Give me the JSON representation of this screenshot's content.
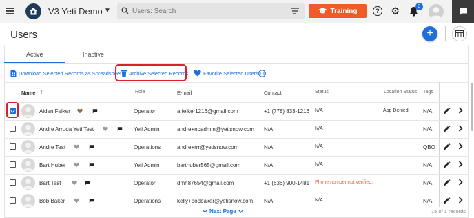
{
  "header": {
    "app_name": "V3 Yeti Demo",
    "search_placeholder": "Users: Search",
    "training_label": "Training",
    "help_glyph": "?",
    "notification_count": "3",
    "icons": [
      "menu-icon",
      "logo-icon",
      "chevron-down-icon",
      "search-icon",
      "filter-icon",
      "graduation-cap-icon",
      "help-icon",
      "gear-icon",
      "bell-icon",
      "user-avatar-icon",
      "chat-icon"
    ]
  },
  "page": {
    "title": "Users",
    "add_glyph": "+"
  },
  "tabs": [
    {
      "label": "Active",
      "active": true
    },
    {
      "label": "Inactive",
      "active": false
    }
  ],
  "actions": {
    "download": "Download Selected Records as Spreadsheet",
    "archive": "Archive Selected Records",
    "favorite": "Favorite Selected Users"
  },
  "columns": {
    "name": "Name",
    "sort_glyph": "↑",
    "role": "Role",
    "email": "E-mail",
    "contact": "Contact",
    "status": "Status",
    "location_status": "Location Status",
    "tags": "Tags"
  },
  "rows": [
    {
      "checked": true,
      "favorite": true,
      "name": "Aiden Felker",
      "role": "Operator",
      "email": "a.felker1216@gmail.com",
      "contact": "+1 (778) 833-1216",
      "status": "N/A",
      "location_status": "App Denied",
      "tags": "N/A"
    },
    {
      "checked": false,
      "favorite": false,
      "name": "Andre Arruda Yeti Test",
      "role": "Yeti Admin",
      "email": "andre+noadmin@yetisnow.com",
      "contact": "N/A",
      "status": "N/A",
      "location_status": "",
      "tags": "N/A"
    },
    {
      "checked": false,
      "favorite": false,
      "name": "Andre Test",
      "role": "Operations",
      "email": "andre+rrr@yetisnow.com",
      "contact": "N/A",
      "status": "N/A",
      "location_status": "",
      "tags": "QBO"
    },
    {
      "checked": false,
      "favorite": false,
      "name": "Bart Huber",
      "role": "Yeti Admin",
      "email": "barthuber565@gmail.com",
      "contact": "N/A",
      "status": "N/A",
      "location_status": "",
      "tags": "N/A"
    },
    {
      "checked": false,
      "favorite": false,
      "name": "Bart Test",
      "role": "Operator",
      "email": "dmh87654@gmail.com",
      "contact": "+1 (636) 900-1481",
      "status": "Phone number not verified.",
      "location_status": "",
      "tags": "N/A"
    },
    {
      "checked": false,
      "favorite": false,
      "name": "Bob Baker",
      "role": "Operations",
      "email": "kelly+bobbaker@yetisnow.com",
      "contact": "N/A",
      "status": "N/A",
      "location_status": "",
      "tags": "N/A"
    }
  ],
  "footer": {
    "next_page": "Next Page",
    "records": "15 of 1 records"
  },
  "colors": {
    "primary": "#1e6fd9",
    "training": "#f05a28",
    "highlight": "#d7222e",
    "warning": "#e0654a",
    "favorite_heart": "#8a6a55",
    "inactive_heart": "#9a9a9a"
  }
}
